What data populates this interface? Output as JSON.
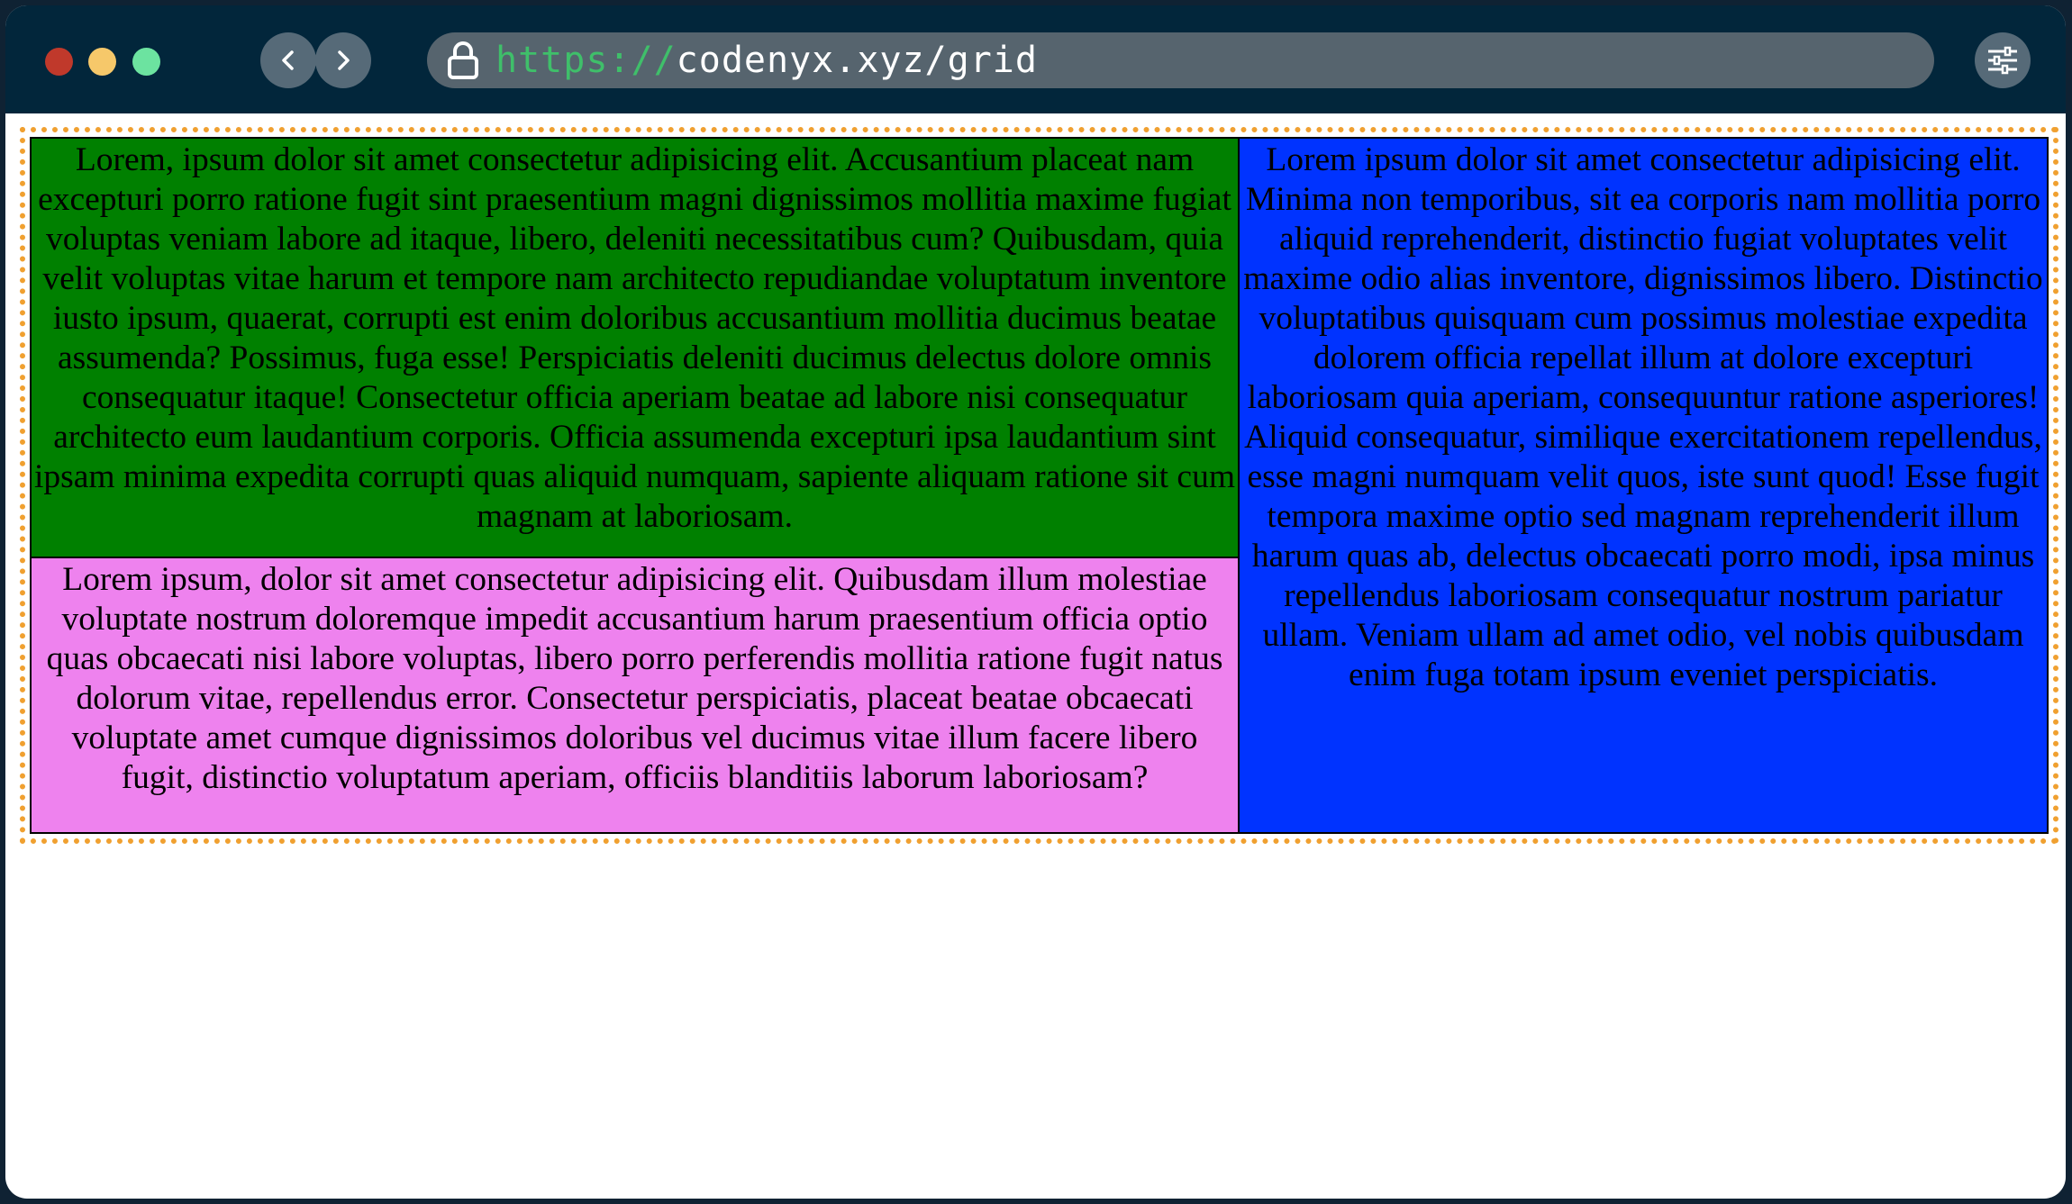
{
  "browser": {
    "url_scheme": "https://",
    "url_host": "codenyx.xyz/grid"
  },
  "colors": {
    "titlebar": "#02263b",
    "cell_green": "#008000",
    "cell_blue": "#0033ff",
    "cell_pink": "#ee82ee",
    "grid_border": "#f0a030"
  },
  "icons": {
    "close": "close-dot",
    "minimize": "minimize-dot",
    "maximize": "maximize-dot",
    "back": "chevron-left-icon",
    "forward": "chevron-right-icon",
    "lock": "lock-icon",
    "settings": "sliders-icon"
  },
  "grid": {
    "cell_green_text": "Lorem, ipsum dolor sit amet consectetur adipisicing elit. Accusantium placeat nam excepturi porro ratione fugit sint praesentium magni dignissimos mollitia maxime fugiat voluptas veniam labore ad itaque, libero, deleniti necessitatibus cum? Quibusdam, quia velit voluptas vitae harum et tempore nam architecto repudiandae voluptatum inventore iusto ipsum, quaerat, corrupti est enim doloribus accusantium mollitia ducimus beatae assumenda? Possimus, fuga esse! Perspiciatis deleniti ducimus delectus dolore omnis consequatur itaque! Consectetur officia aperiam beatae ad labore nisi consequatur architecto eum laudantium corporis. Officia assumenda excepturi ipsa laudantium sint ipsam minima expedita corrupti quas aliquid numquam, sapiente aliquam ratione sit cum magnam at laboriosam.",
    "cell_blue_text": "Lorem ipsum dolor sit amet consectetur adipisicing elit. Minima non temporibus, sit ea corporis nam mollitia porro aliquid reprehenderit, distinctio fugiat voluptates velit maxime odio alias inventore, dignissimos libero. Distinctio voluptatibus quisquam cum possimus molestiae expedita dolorem officia repellat illum at dolore excepturi laboriosam quia aperiam, consequuntur ratione asperiores! Aliquid consequatur, similique exercitationem repellendus, esse magni numquam velit quos, iste sunt quod! Esse fugit tempora maxime optio sed magnam reprehenderit illum harum quas ab, delectus obcaecati porro modi, ipsa minus repellendus laboriosam consequatur nostrum pariatur ullam. Veniam ullam ad amet odio, vel nobis quibusdam enim fuga totam ipsum eveniet perspiciatis.",
    "cell_pink_text": "Lorem ipsum, dolor sit amet consectetur adipisicing elit. Quibusdam illum molestiae voluptate nostrum doloremque impedit accusantium harum praesentium officia optio quas obcaecati nisi labore voluptas, libero porro perferendis mollitia ratione fugit natus dolorum vitae, repellendus error. Consectetur perspiciatis, placeat beatae obcaecati voluptate amet cumque dignissimos doloribus vel ducimus vitae illum facere libero fugit, distinctio voluptatum aperiam, officiis blanditiis laborum laboriosam?"
  }
}
